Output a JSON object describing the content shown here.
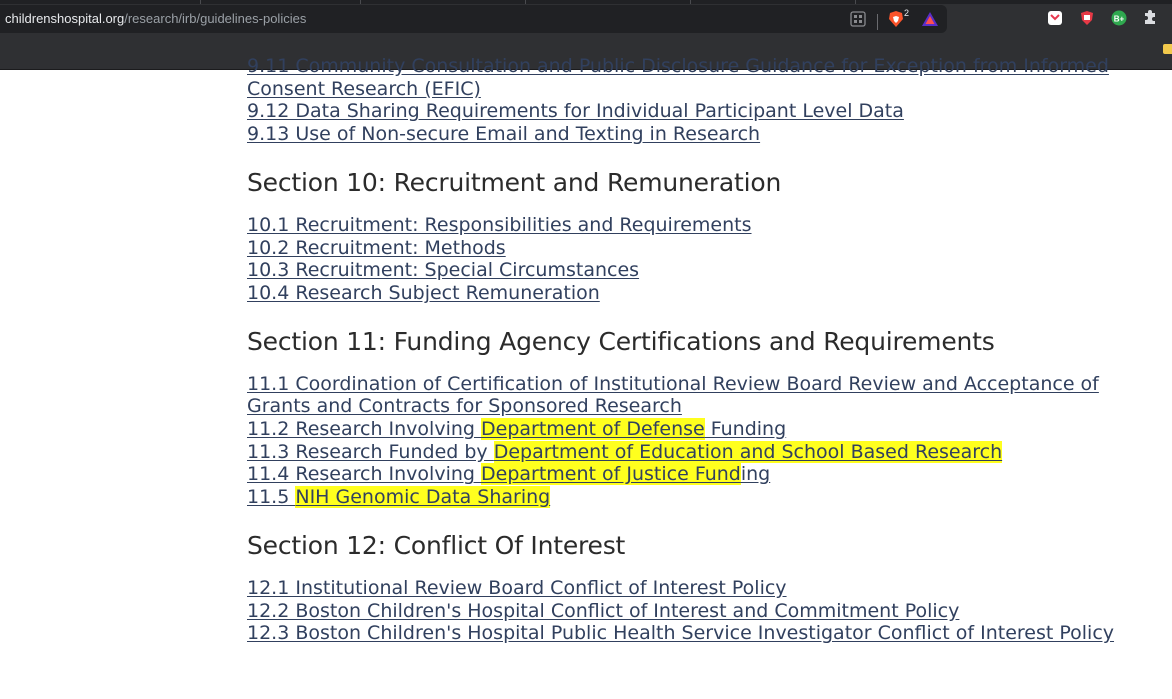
{
  "browser": {
    "url_host": "childrenshospital.org",
    "url_path": "/research/irb/guidelines-policies",
    "brave_badge": "2",
    "colors": {
      "chrome": "#2f3033",
      "urlbar": "#202124",
      "link": "#31405e",
      "highlight": "#ffff1e"
    },
    "icons": [
      "grid-icon",
      "brave-lion-icon",
      "rewards-triangle-icon",
      "pocket-icon",
      "shield-extension-icon",
      "bplus-extension-icon",
      "puzzle-extensions-icon"
    ]
  },
  "content": {
    "section9": {
      "links": [
        {
          "text": "9.11 Community Consultation and Public Disclosure Guidance for Exception from Informed Consent Research (EFIC)"
        },
        {
          "text": "9.12 Data Sharing Requirements for Individual Participant Level Data"
        },
        {
          "text": "9.13 Use of Non-secure Email and Texting in Research"
        }
      ]
    },
    "section10": {
      "heading": "Section 10: Recruitment and Remuneration",
      "links": [
        {
          "text": "10.1 Recruitment: Responsibilities and Requirements"
        },
        {
          "text": "10.2 Recruitment: Methods"
        },
        {
          "text": "10.3 Recruitment: Special Circumstances"
        },
        {
          "text": "10.4 Research Subject Remuneration"
        }
      ]
    },
    "section11": {
      "heading": "Section 11: Funding Agency Certifications and Requirements",
      "links": [
        {
          "text": "11.1 Coordination of Certification of Institutional Review Board Review and Acceptance of Grants and Contracts for Sponsored Research"
        },
        {
          "pre": "11.2 Research Involving ",
          "hl": "Department of Defense",
          "post": " Funding"
        },
        {
          "pre": "11.3 Research Funded by ",
          "hl": "Department of Education and School Based Research",
          "post": ""
        },
        {
          "pre": "11.4 Research Involving ",
          "hl": "Department of Justice Fund",
          "post": "ing"
        },
        {
          "pre": "11.5 ",
          "hl": "NIH Genomic Data Sharing",
          "post": ""
        }
      ]
    },
    "section12": {
      "heading": "Section 12: Conflict Of Interest",
      "links": [
        {
          "text": "12.1 Institutional Review Board Conflict of Interest Policy"
        },
        {
          "text": "12.2 Boston Children's Hospital Conflict of Interest and Commitment Policy"
        },
        {
          "text": "12.3 Boston Children's Hospital Public Health Service Investigator Conflict of Interest Policy"
        }
      ]
    }
  }
}
